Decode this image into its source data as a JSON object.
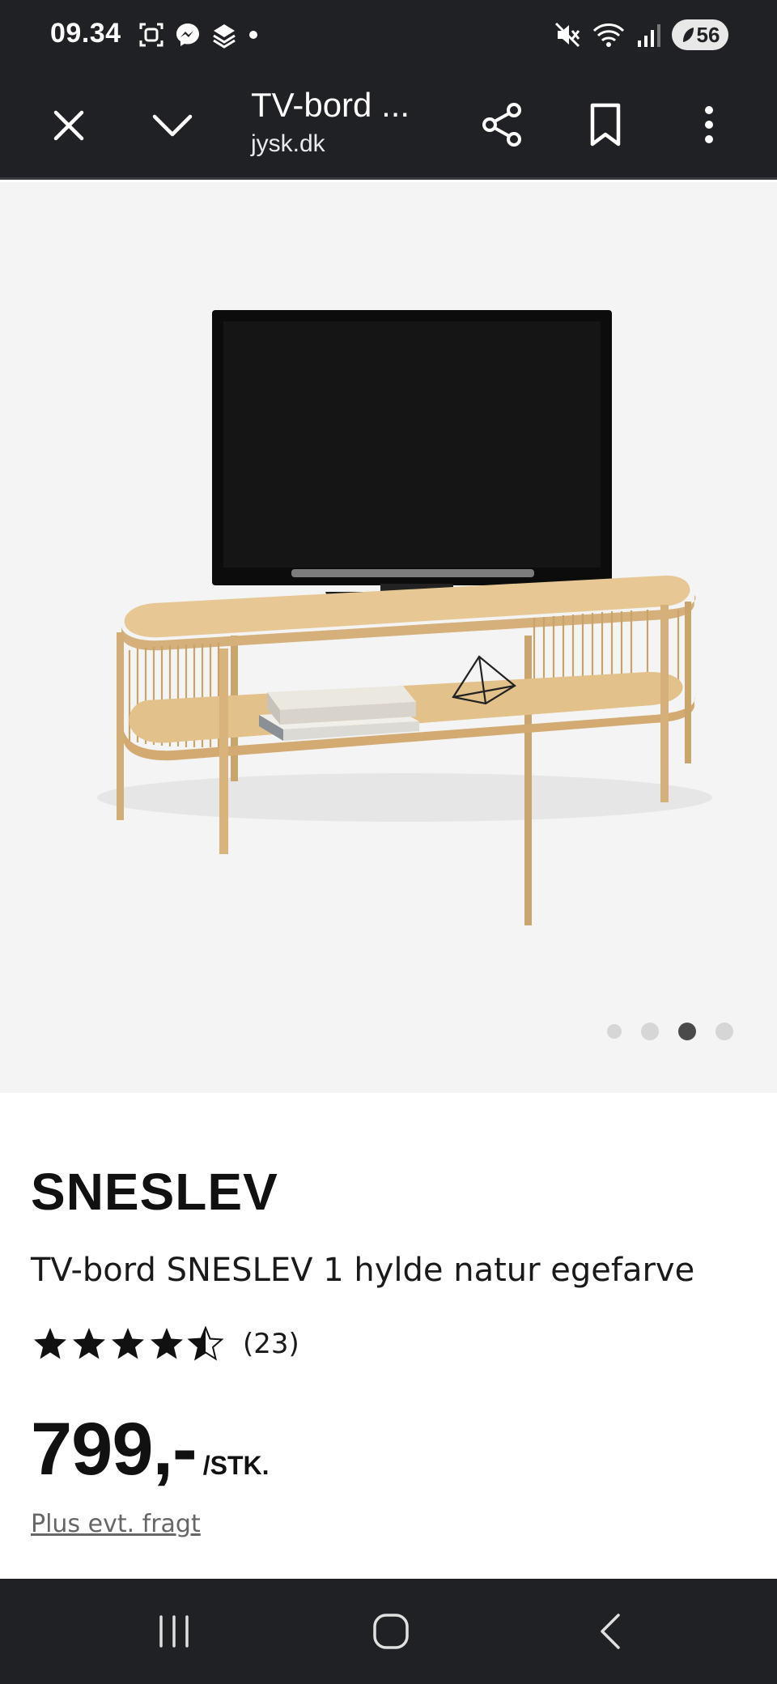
{
  "status_bar": {
    "time": "09.34",
    "battery": "56",
    "icons": [
      "screenshot-icon",
      "messenger-icon",
      "stack-icon",
      "dot-icon",
      "mute-icon",
      "wifi-icon",
      "signal-icon",
      "battery-icon"
    ]
  },
  "toolbar": {
    "title": "TV-bord ...",
    "url": "jysk.dk",
    "icons": [
      "close-icon",
      "chevron-down-icon",
      "share-icon",
      "bookmark-icon",
      "more-vert-icon"
    ]
  },
  "gallery": {
    "slide_count": 4,
    "active_slide": 3,
    "colors": {
      "background": "#f4f4f4",
      "dot": "#d6d6d6",
      "dot_active": "#4a4a4a"
    }
  },
  "product": {
    "brand": "SNESLEV",
    "name": "TV-bord SNESLEV 1 hylde natur egefarve",
    "rating": 4.5,
    "rating_max": 5,
    "review_count": "(23)",
    "price": "799,-",
    "unit": "/STK.",
    "shipping_link": "Plus evt. fragt"
  },
  "nav_bar": {
    "icons": [
      "recents-icon",
      "home-icon",
      "back-icon"
    ]
  },
  "colors": {
    "system_bar": "#202124",
    "text": "#111111",
    "muted": "#666666"
  }
}
